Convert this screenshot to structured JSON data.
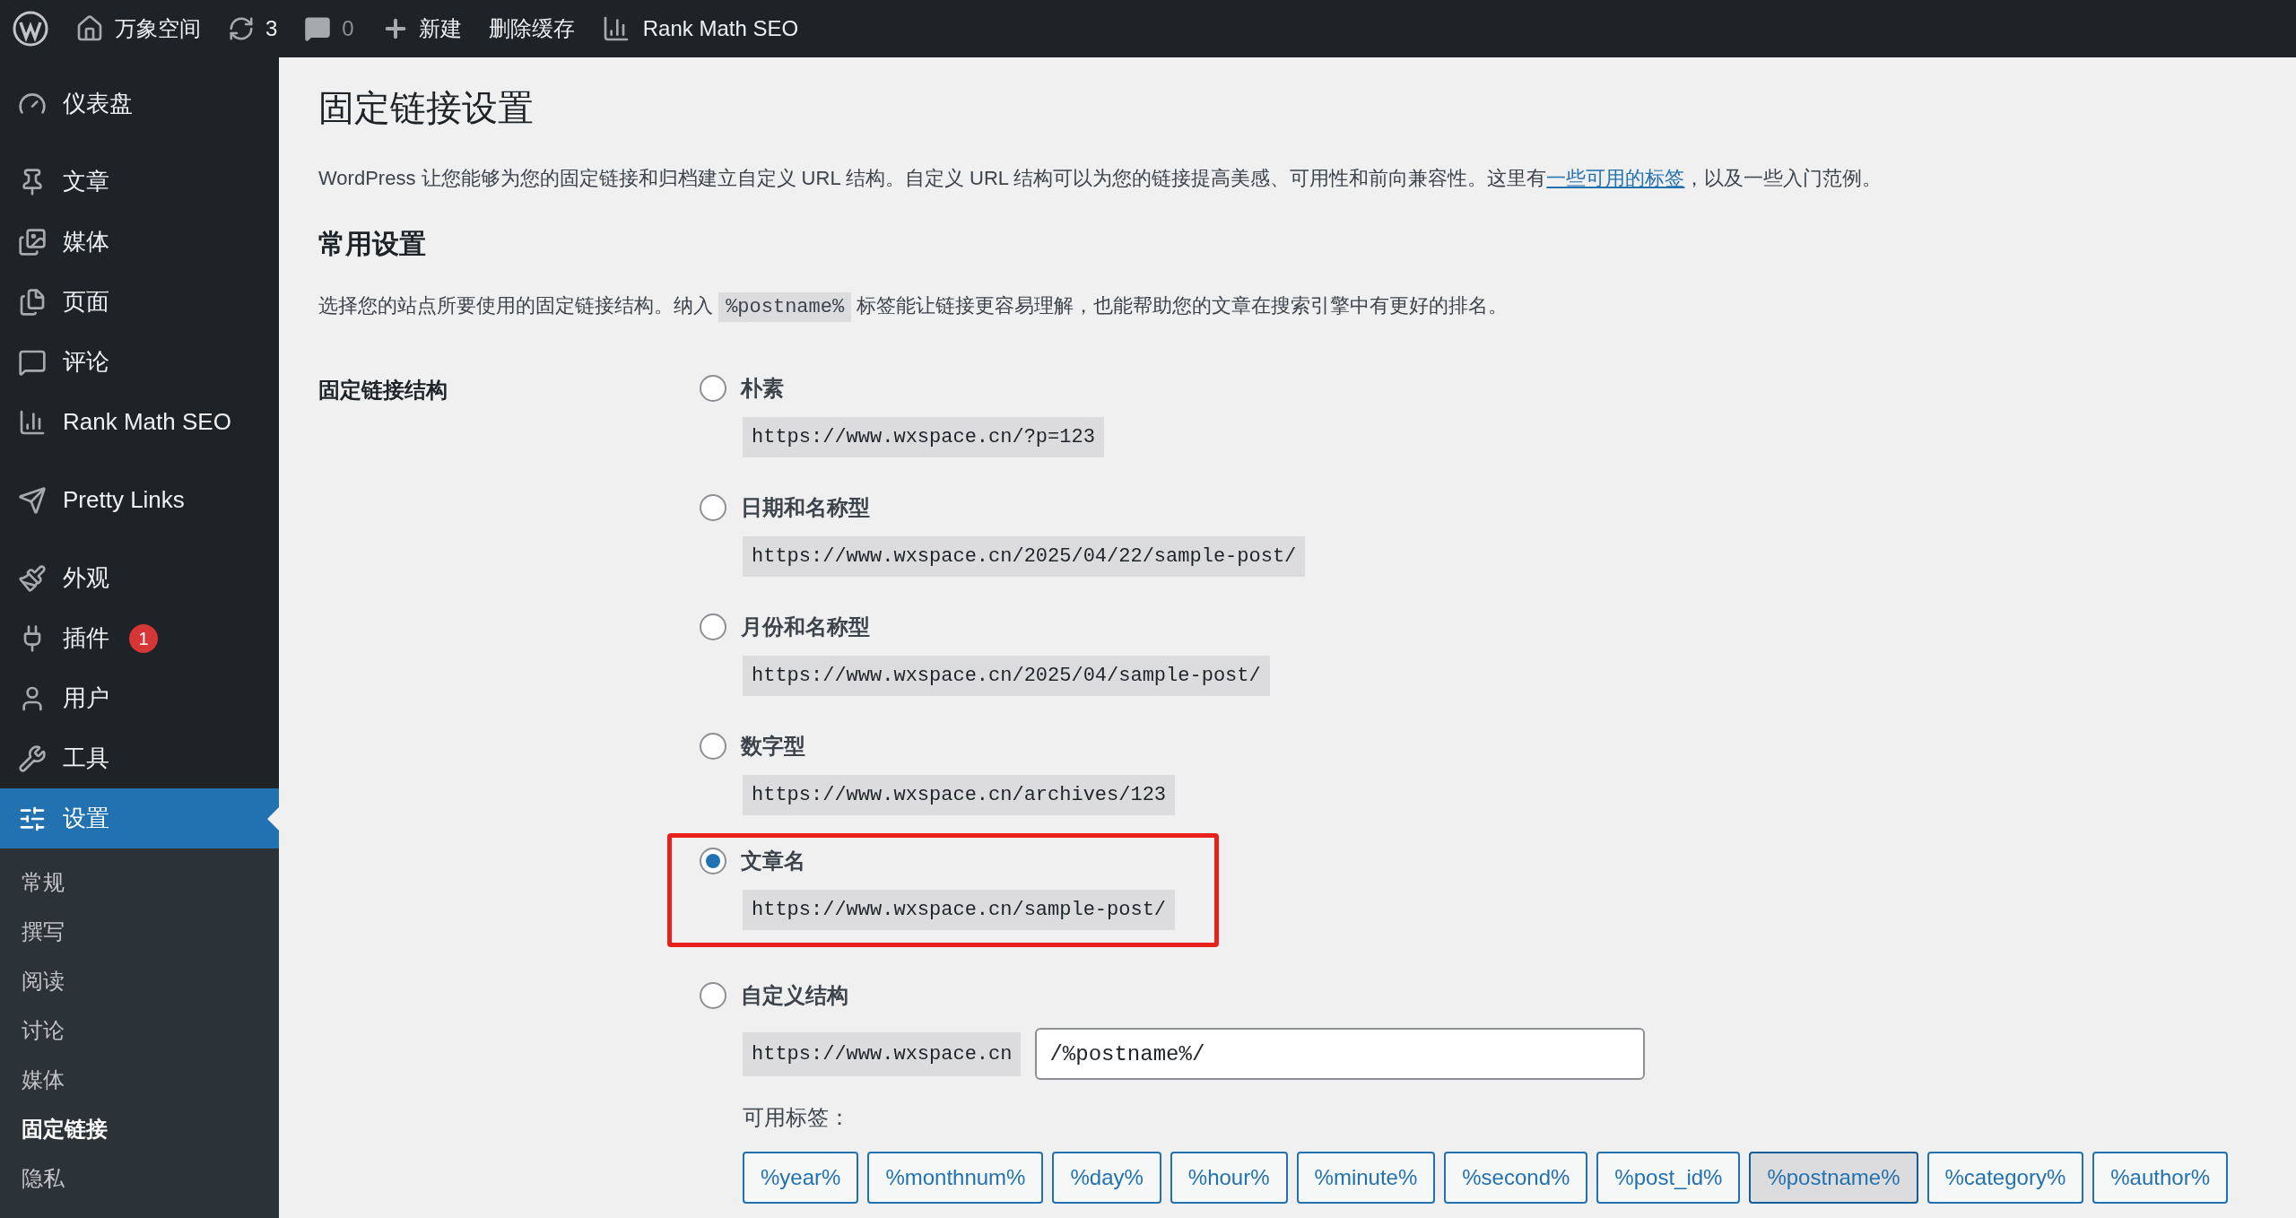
{
  "admin_bar": {
    "site": "万象空间",
    "updates": "3",
    "comments": "0",
    "new": "新建",
    "clear_cache": "删除缓存",
    "seo": "Rank Math SEO"
  },
  "sidebar": {
    "items": [
      {
        "label": "仪表盘",
        "selected": false
      },
      {
        "label": "文章",
        "selected": false
      },
      {
        "label": "媒体",
        "selected": false
      },
      {
        "label": "页面",
        "selected": false
      },
      {
        "label": "评论",
        "selected": false
      },
      {
        "label": "Rank Math SEO",
        "selected": false
      },
      {
        "label": "Pretty Links",
        "selected": false
      },
      {
        "label": "外观",
        "selected": false
      },
      {
        "label": "插件",
        "selected": false,
        "badge": "1"
      },
      {
        "label": "用户",
        "selected": false
      },
      {
        "label": "工具",
        "selected": false
      },
      {
        "label": "设置",
        "selected": true
      }
    ],
    "submenu": [
      {
        "label": "常规",
        "selected": false
      },
      {
        "label": "撰写",
        "selected": false
      },
      {
        "label": "阅读",
        "selected": false
      },
      {
        "label": "讨论",
        "selected": false
      },
      {
        "label": "媒体",
        "selected": false
      },
      {
        "label": "固定链接",
        "selected": true
      },
      {
        "label": "隐私",
        "selected": false
      }
    ]
  },
  "page": {
    "title": "固定链接设置",
    "intro": {
      "before": "WordPress 让您能够为您的固定链接和归档建立自定义 URL 结构。自定义 URL 结构可以为您的链接提高美感、可用性和前向兼容性。这里有",
      "link": "一些可用的标签",
      "after": "，以及一些入门范例。"
    },
    "section_title": "常用设置",
    "section_desc": {
      "before": "选择您的站点所要使用的固定链接结构。纳入",
      "code": "%postname%",
      "after": "标签能让链接更容易理解，也能帮助您的文章在搜索引擎中有更好的排名。"
    },
    "field_label": "固定链接结构",
    "options": [
      {
        "kind": "preset",
        "label": "朴素",
        "example": "https://www.wxspace.cn/?p=123",
        "selected": false,
        "highlighted": false
      },
      {
        "kind": "preset",
        "label": "日期和名称型",
        "example": "https://www.wxspace.cn/2025/04/22/sample-post/",
        "selected": false,
        "highlighted": false
      },
      {
        "kind": "preset",
        "label": "月份和名称型",
        "example": "https://www.wxspace.cn/2025/04/sample-post/",
        "selected": false,
        "highlighted": false
      },
      {
        "kind": "preset",
        "label": "数字型",
        "example": "https://www.wxspace.cn/archives/123",
        "selected": false,
        "highlighted": false
      },
      {
        "kind": "preset",
        "label": "文章名",
        "example": "https://www.wxspace.cn/sample-post/",
        "selected": true,
        "highlighted": true
      },
      {
        "kind": "custom",
        "label": "自定义结构",
        "example": "https://www.wxspace.cn",
        "value": "/%postname%/",
        "selected": false,
        "highlighted": false
      }
    ],
    "tags_label": "可用标签：",
    "tags": [
      {
        "label": "%year%",
        "selected": false
      },
      {
        "label": "%monthnum%",
        "selected": false
      },
      {
        "label": "%day%",
        "selected": false
      },
      {
        "label": "%hour%",
        "selected": false
      },
      {
        "label": "%minute%",
        "selected": false
      },
      {
        "label": "%second%",
        "selected": false
      },
      {
        "label": "%post_id%",
        "selected": false
      },
      {
        "label": "%postname%",
        "selected": true
      },
      {
        "label": "%category%",
        "selected": false
      },
      {
        "label": "%author%",
        "selected": false
      }
    ]
  }
}
